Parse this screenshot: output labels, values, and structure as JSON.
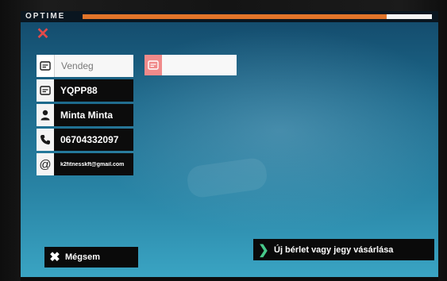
{
  "app": {
    "logo": "OPTIME"
  },
  "progress": {
    "fraction": 0.87
  },
  "fields": [
    {
      "label": "Vendeg",
      "icon": "card-icon",
      "style": "light"
    },
    {
      "label": "YQPP88",
      "icon": "card-icon",
      "style": "dark"
    },
    {
      "label": "Minta Minta",
      "icon": "person-icon",
      "style": "dark"
    },
    {
      "label": "06704332097",
      "icon": "phone-icon",
      "style": "dark"
    },
    {
      "label": "k2fitnesskft@gmail.com",
      "icon": "at-icon",
      "style": "dark"
    }
  ],
  "secondary_card": {
    "label": "",
    "icon": "card-icon"
  },
  "buttons": {
    "cancel": "Mégsem",
    "buy": "Új bérlet vagy jegy vásárlása"
  },
  "colors": {
    "accent_orange": "#e0742a",
    "close_red": "#e24a4a",
    "arrow_green": "#47c98a",
    "card_pink": "#f08a8a",
    "screen_blue": "#1d6a8c"
  }
}
